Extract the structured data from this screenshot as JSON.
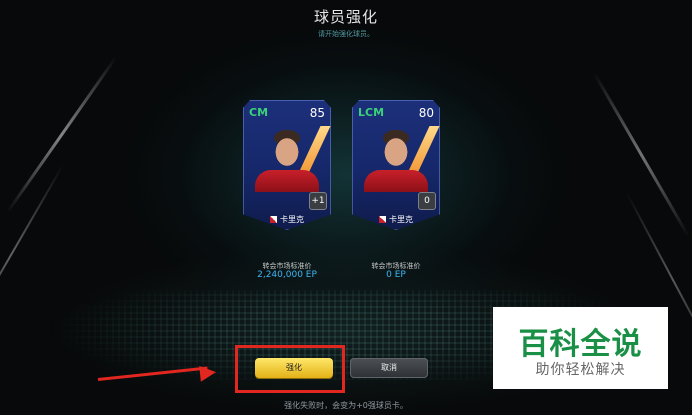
{
  "header": {
    "title": "球员强化",
    "subtitle": "请开始强化球员。"
  },
  "cards": [
    {
      "position": "CM",
      "rating": "85",
      "name": "卡里克",
      "level_badge": "+1",
      "price_label": "转会市场标准价",
      "price_value": "2,240,000 EP"
    },
    {
      "position": "LCM",
      "rating": "80",
      "name": "卡里克",
      "level_badge": "0",
      "price_label": "转会市场标准价",
      "price_value": "0 EP"
    }
  ],
  "buttons": {
    "enhance": "强化",
    "cancel": "取消"
  },
  "footer": {
    "note": "强化失败时，会变为+0强球员卡。"
  },
  "watermark": {
    "main": "百科全说",
    "sub": "助你轻松解决"
  },
  "colors": {
    "accent_yellow": "#f2c935",
    "price_blue": "#3db6f3",
    "position_green": "#3bd17a",
    "annotation_red": "#e1271f",
    "watermark_green": "#1a8f46"
  },
  "icons": {
    "nation_flag": "flag-icon",
    "arrow": "arrow-icon"
  }
}
